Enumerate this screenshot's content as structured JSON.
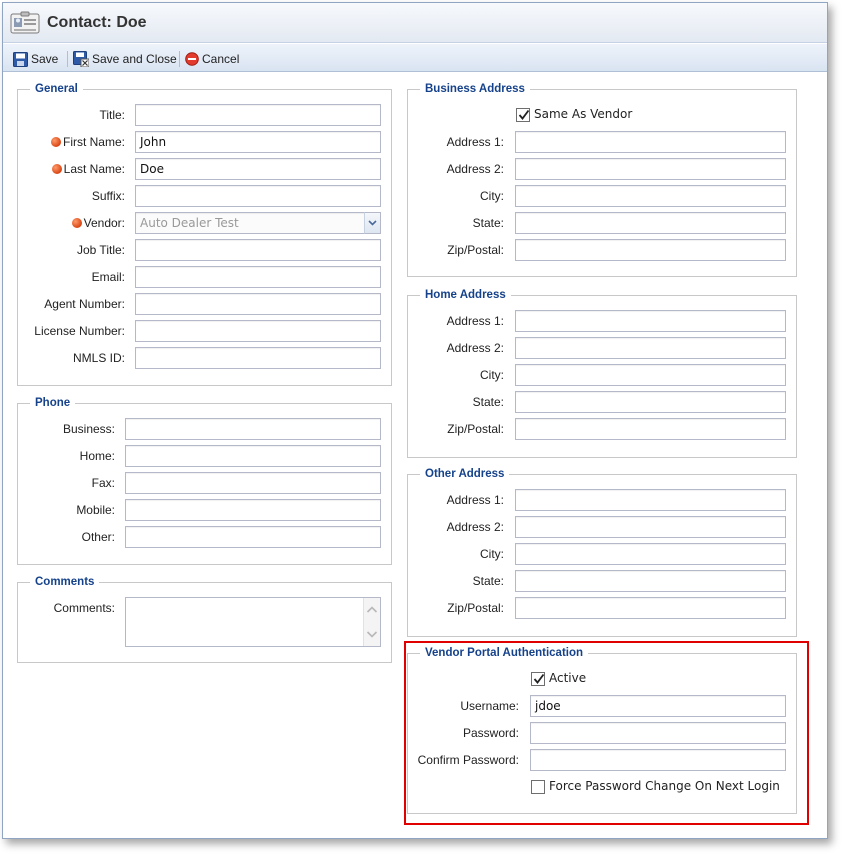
{
  "window": {
    "title": "Contact: Doe",
    "icon": "contact-card-icon"
  },
  "toolbar": {
    "save_label": "Save",
    "save_close_label": "Save and Close",
    "cancel_label": "Cancel"
  },
  "general": {
    "legend": "General",
    "title_label": "Title:",
    "title_value": "",
    "first_name_label": "First Name:",
    "first_name_value": "John",
    "last_name_label": "Last Name:",
    "last_name_value": "Doe",
    "suffix_label": "Suffix:",
    "suffix_value": "",
    "vendor_label": "Vendor:",
    "vendor_value": "Auto Dealer Test",
    "job_title_label": "Job Title:",
    "job_title_value": "",
    "email_label": "Email:",
    "email_value": "",
    "agent_number_label": "Agent Number:",
    "agent_number_value": "",
    "license_number_label": "License Number:",
    "license_number_value": "",
    "nmls_label": "NMLS ID:",
    "nmls_value": ""
  },
  "phone": {
    "legend": "Phone",
    "business_label": "Business:",
    "home_label": "Home:",
    "fax_label": "Fax:",
    "mobile_label": "Mobile:",
    "other_label": "Other:"
  },
  "comments": {
    "legend": "Comments",
    "comments_label": "Comments:"
  },
  "business_address": {
    "legend": "Business Address",
    "same_as_vendor_label": "Same As Vendor",
    "same_as_vendor_checked": true,
    "address1_label": "Address 1:",
    "address2_label": "Address 2:",
    "city_label": "City:",
    "state_label": "State:",
    "zip_label": "Zip/Postal:"
  },
  "home_address": {
    "legend": "Home Address",
    "address1_label": "Address 1:",
    "address2_label": "Address 2:",
    "city_label": "City:",
    "state_label": "State:",
    "zip_label": "Zip/Postal:"
  },
  "other_address": {
    "legend": "Other Address",
    "address1_label": "Address 1:",
    "address2_label": "Address 2:",
    "city_label": "City:",
    "state_label": "State:",
    "zip_label": "Zip/Postal:"
  },
  "vendor_portal": {
    "legend": "Vendor Portal Authentication",
    "active_label": "Active",
    "active_checked": true,
    "username_label": "Username:",
    "username_value": "jdoe",
    "password_label": "Password:",
    "confirm_password_label": "Confirm Password:",
    "force_change_label": "Force Password Change On Next Login",
    "force_change_checked": false
  },
  "colors": {
    "legend": "#15428b",
    "required_dot": "#d94413",
    "highlight": "#e00000"
  }
}
